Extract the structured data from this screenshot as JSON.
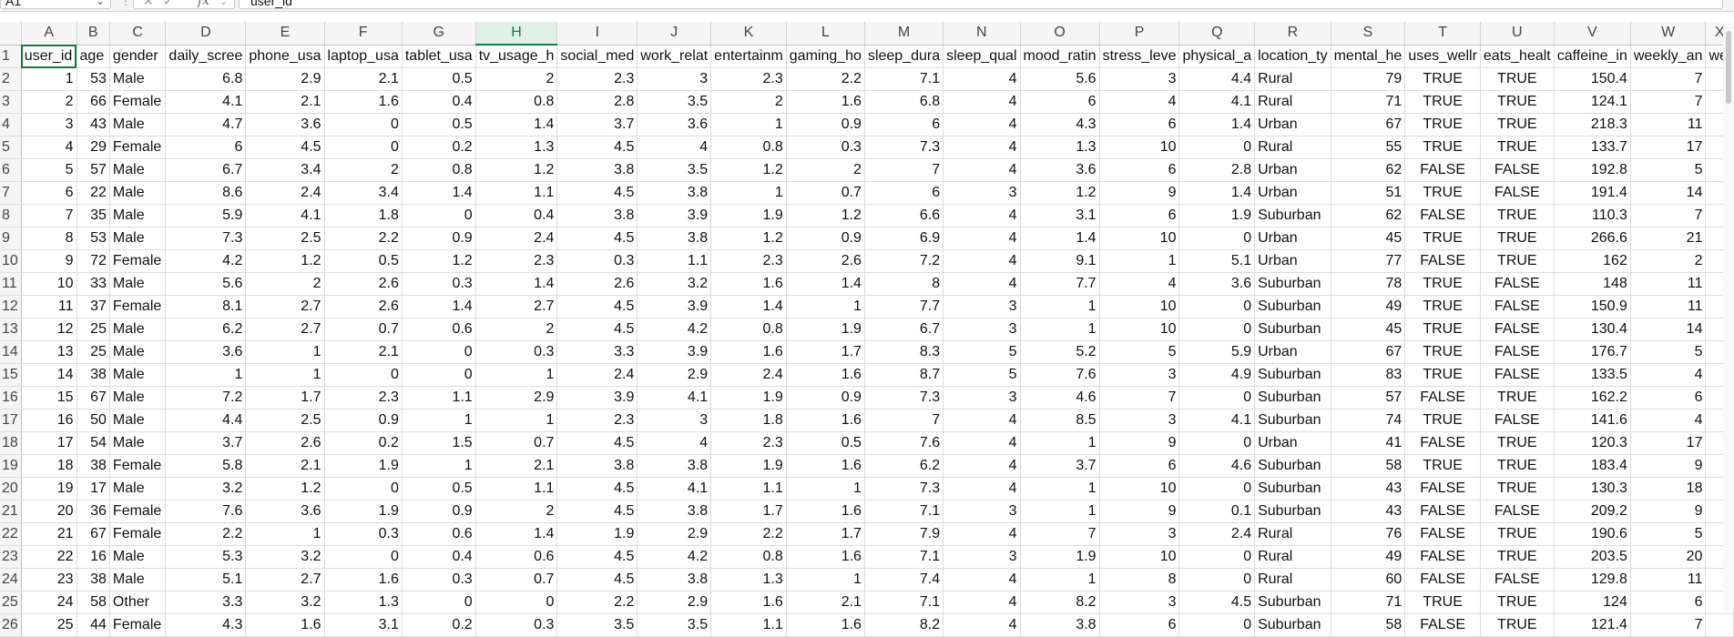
{
  "formula_bar": {
    "name_box": "A1",
    "formula_value": "user_id",
    "fx_label": "fx",
    "cancel_glyph": "✕",
    "enter_glyph": "✓",
    "chevron_glyph": "⌄"
  },
  "grid": {
    "column_letters": [
      "A",
      "B",
      "C",
      "D",
      "E",
      "F",
      "G",
      "H",
      "I",
      "J",
      "K",
      "L",
      "M",
      "N",
      "O",
      "P",
      "Q",
      "R",
      "S",
      "T",
      "U",
      "V",
      "W",
      "X"
    ],
    "selected_column": "H",
    "row_numbers": [
      "1",
      "2",
      "3",
      "4",
      "5",
      "6",
      "7",
      "8",
      "9",
      "10",
      "11",
      "12",
      "13",
      "14",
      "15",
      "16",
      "17",
      "18",
      "19",
      "20",
      "21",
      "22",
      "23",
      "24",
      "25",
      "26"
    ],
    "headers": [
      "user_id",
      "age",
      "gender",
      "daily_scree",
      "phone_usa",
      "laptop_usa",
      "tablet_usa",
      "tv_usage_h",
      "social_med",
      "work_relat",
      "entertainm",
      "gaming_ho",
      "sleep_dura",
      "sleep_qual",
      "mood_ratin",
      "stress_leve",
      "physical_a",
      "location_ty",
      "mental_he",
      "uses_wellr",
      "eats_healt",
      "caffeine_in",
      "weekly_an",
      "we"
    ],
    "rows": [
      [
        "1",
        "53",
        "Male",
        "6.8",
        "2.9",
        "2.1",
        "0.5",
        "2",
        "2.3",
        "3",
        "2.3",
        "2.2",
        "7.1",
        "4",
        "5.6",
        "3",
        "4.4",
        "Rural",
        "79",
        "TRUE",
        "TRUE",
        "150.4",
        "7"
      ],
      [
        "2",
        "66",
        "Female",
        "4.1",
        "2.1",
        "1.6",
        "0.4",
        "0.8",
        "2.8",
        "3.5",
        "2",
        "1.6",
        "6.8",
        "4",
        "6",
        "4",
        "4.1",
        "Rural",
        "71",
        "TRUE",
        "TRUE",
        "124.1",
        "7"
      ],
      [
        "3",
        "43",
        "Male",
        "4.7",
        "3.6",
        "0",
        "0.5",
        "1.4",
        "3.7",
        "3.6",
        "1",
        "0.9",
        "6",
        "4",
        "4.3",
        "6",
        "1.4",
        "Urban",
        "67",
        "TRUE",
        "TRUE",
        "218.3",
        "11"
      ],
      [
        "4",
        "29",
        "Female",
        "6",
        "4.5",
        "0",
        "0.2",
        "1.3",
        "4.5",
        "4",
        "0.8",
        "0.3",
        "7.3",
        "4",
        "1.3",
        "10",
        "0",
        "Rural",
        "55",
        "TRUE",
        "TRUE",
        "133.7",
        "17"
      ],
      [
        "5",
        "57",
        "Male",
        "6.7",
        "3.4",
        "2",
        "0.8",
        "1.2",
        "3.8",
        "3.5",
        "1.2",
        "2",
        "7",
        "4",
        "3.6",
        "6",
        "2.8",
        "Urban",
        "62",
        "FALSE",
        "FALSE",
        "192.8",
        "5"
      ],
      [
        "6",
        "22",
        "Male",
        "8.6",
        "2.4",
        "3.4",
        "1.4",
        "1.1",
        "4.5",
        "3.8",
        "1",
        "0.7",
        "6",
        "3",
        "1.2",
        "9",
        "1.4",
        "Urban",
        "51",
        "TRUE",
        "FALSE",
        "191.4",
        "14"
      ],
      [
        "7",
        "35",
        "Male",
        "5.9",
        "4.1",
        "1.8",
        "0",
        "0.4",
        "3.8",
        "3.9",
        "1.9",
        "1.2",
        "6.6",
        "4",
        "3.1",
        "6",
        "1.9",
        "Suburban",
        "62",
        "FALSE",
        "TRUE",
        "110.3",
        "7"
      ],
      [
        "8",
        "53",
        "Male",
        "7.3",
        "2.5",
        "2.2",
        "0.9",
        "2.4",
        "4.5",
        "3.8",
        "1.2",
        "0.9",
        "6.9",
        "4",
        "1.4",
        "10",
        "0",
        "Urban",
        "45",
        "TRUE",
        "TRUE",
        "266.6",
        "21"
      ],
      [
        "9",
        "72",
        "Female",
        "4.2",
        "1.2",
        "0.5",
        "1.2",
        "2.3",
        "0.3",
        "1.1",
        "2.3",
        "2.6",
        "7.2",
        "4",
        "9.1",
        "1",
        "5.1",
        "Urban",
        "77",
        "FALSE",
        "TRUE",
        "162",
        "2"
      ],
      [
        "10",
        "33",
        "Male",
        "5.6",
        "2",
        "2.6",
        "0.3",
        "1.4",
        "2.6",
        "3.2",
        "1.6",
        "1.4",
        "8",
        "4",
        "7.7",
        "4",
        "3.6",
        "Suburban",
        "78",
        "TRUE",
        "FALSE",
        "148",
        "11"
      ],
      [
        "11",
        "37",
        "Female",
        "8.1",
        "2.7",
        "2.6",
        "1.4",
        "2.7",
        "4.5",
        "3.9",
        "1.4",
        "1",
        "7.7",
        "3",
        "1",
        "10",
        "0",
        "Suburban",
        "49",
        "TRUE",
        "FALSE",
        "150.9",
        "11"
      ],
      [
        "12",
        "25",
        "Male",
        "6.2",
        "2.7",
        "0.7",
        "0.6",
        "2",
        "4.5",
        "4.2",
        "0.8",
        "1.9",
        "6.7",
        "3",
        "1",
        "10",
        "0",
        "Suburban",
        "45",
        "TRUE",
        "FALSE",
        "130.4",
        "14"
      ],
      [
        "13",
        "25",
        "Male",
        "3.6",
        "1",
        "2.1",
        "0",
        "0.3",
        "3.3",
        "3.9",
        "1.6",
        "1.7",
        "8.3",
        "5",
        "5.2",
        "5",
        "5.9",
        "Urban",
        "67",
        "TRUE",
        "FALSE",
        "176.7",
        "5"
      ],
      [
        "14",
        "38",
        "Male",
        "1",
        "1",
        "0",
        "0",
        "1",
        "2.4",
        "2.9",
        "2.4",
        "1.6",
        "8.7",
        "5",
        "7.6",
        "3",
        "4.9",
        "Suburban",
        "83",
        "TRUE",
        "FALSE",
        "133.5",
        "4"
      ],
      [
        "15",
        "67",
        "Male",
        "7.2",
        "1.7",
        "2.3",
        "1.1",
        "2.9",
        "3.9",
        "4.1",
        "1.9",
        "0.9",
        "7.3",
        "3",
        "4.6",
        "7",
        "0",
        "Suburban",
        "57",
        "FALSE",
        "TRUE",
        "162.2",
        "6"
      ],
      [
        "16",
        "50",
        "Male",
        "4.4",
        "2.5",
        "0.9",
        "1",
        "1",
        "2.3",
        "3",
        "1.8",
        "1.6",
        "7",
        "4",
        "8.5",
        "3",
        "4.1",
        "Suburban",
        "74",
        "TRUE",
        "FALSE",
        "141.6",
        "4"
      ],
      [
        "17",
        "54",
        "Male",
        "3.7",
        "2.6",
        "0.2",
        "1.5",
        "0.7",
        "4.5",
        "4",
        "2.3",
        "0.5",
        "7.6",
        "4",
        "1",
        "9",
        "0",
        "Urban",
        "41",
        "FALSE",
        "TRUE",
        "120.3",
        "17"
      ],
      [
        "18",
        "38",
        "Female",
        "5.8",
        "2.1",
        "1.9",
        "1",
        "2.1",
        "3.8",
        "3.8",
        "1.9",
        "1.6",
        "6.2",
        "4",
        "3.7",
        "6",
        "4.6",
        "Suburban",
        "58",
        "TRUE",
        "TRUE",
        "183.4",
        "9"
      ],
      [
        "19",
        "17",
        "Male",
        "3.2",
        "1.2",
        "0",
        "0.5",
        "1.1",
        "4.5",
        "4.1",
        "1.1",
        "1",
        "7.3",
        "4",
        "1",
        "10",
        "0",
        "Suburban",
        "43",
        "FALSE",
        "TRUE",
        "130.3",
        "18"
      ],
      [
        "20",
        "36",
        "Female",
        "7.6",
        "3.6",
        "1.9",
        "0.9",
        "2",
        "4.5",
        "3.8",
        "1.7",
        "1.6",
        "7.1",
        "3",
        "1",
        "9",
        "0.1",
        "Suburban",
        "43",
        "FALSE",
        "FALSE",
        "209.2",
        "9"
      ],
      [
        "21",
        "67",
        "Female",
        "2.2",
        "1",
        "0.3",
        "0.6",
        "1.4",
        "1.9",
        "2.9",
        "2.2",
        "1.7",
        "7.9",
        "4",
        "7",
        "3",
        "2.4",
        "Rural",
        "76",
        "FALSE",
        "TRUE",
        "190.6",
        "5"
      ],
      [
        "22",
        "16",
        "Male",
        "5.3",
        "3.2",
        "0",
        "0.4",
        "0.6",
        "4.5",
        "4.2",
        "0.8",
        "1.6",
        "7.1",
        "3",
        "1.9",
        "10",
        "0",
        "Rural",
        "49",
        "FALSE",
        "TRUE",
        "203.5",
        "20"
      ],
      [
        "23",
        "38",
        "Male",
        "5.1",
        "2.7",
        "1.6",
        "0.3",
        "0.7",
        "4.5",
        "3.8",
        "1.3",
        "1",
        "7.4",
        "4",
        "1",
        "8",
        "0",
        "Rural",
        "60",
        "FALSE",
        "FALSE",
        "129.8",
        "11"
      ],
      [
        "24",
        "58",
        "Other",
        "3.3",
        "3.2",
        "1.3",
        "0",
        "0",
        "2.2",
        "2.9",
        "1.6",
        "2.1",
        "7.1",
        "4",
        "8.2",
        "3",
        "4.5",
        "Suburban",
        "71",
        "TRUE",
        "TRUE",
        "124",
        "6"
      ],
      [
        "25",
        "44",
        "Female",
        "4.3",
        "1.6",
        "3.1",
        "0.2",
        "0.3",
        "3.5",
        "3.5",
        "1.1",
        "1.6",
        "8.2",
        "4",
        "3.8",
        "6",
        "0",
        "Suburban",
        "58",
        "FALSE",
        "TRUE",
        "121.4",
        "7"
      ]
    ]
  }
}
